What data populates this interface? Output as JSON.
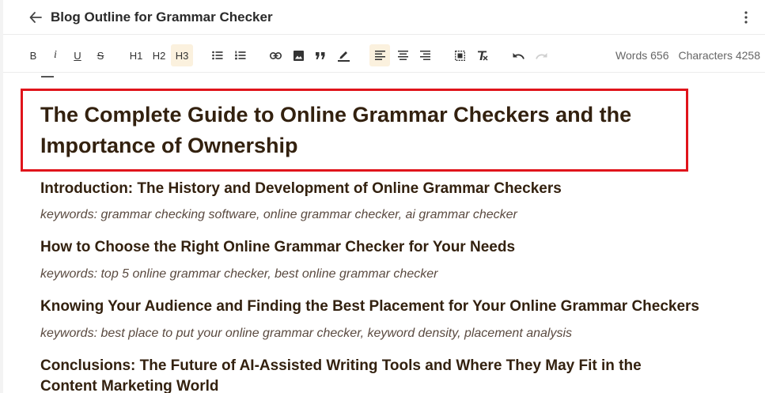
{
  "header": {
    "title": "Blog Outline for Grammar Checker"
  },
  "toolbar": {
    "bold": "B",
    "italic": "i",
    "underline": "U",
    "strike": "S",
    "h1": "H1",
    "h2": "H2",
    "h3": "H3",
    "words_label": "Words 656",
    "characters_label": "Characters 4258"
  },
  "document": {
    "title": "The Complete Guide to Online Grammar Checkers and the Importance of Ownership",
    "sections": [
      {
        "heading": "Introduction: The History and Development of Online Grammar Checkers",
        "keywords": "keywords: grammar checking software, online grammar checker, ai grammar checker"
      },
      {
        "heading": "How to Choose the Right Online Grammar Checker for Your Needs",
        "keywords": "keywords: top 5 online grammar checker, best online grammar checker"
      },
      {
        "heading": "Knowing Your Audience and Finding the Best Placement for Your Online Grammar Checkers",
        "keywords": "keywords: best place to put your online grammar checker, keyword density, placement analysis"
      },
      {
        "heading": "Conclusions: The Future of AI-Assisted Writing Tools and Where They May Fit in the Content Marketing World"
      }
    ]
  },
  "colors": {
    "highlight_box": "#e0141b",
    "active_button_bg": "#fbf1de",
    "heading_text": "#33210f"
  }
}
